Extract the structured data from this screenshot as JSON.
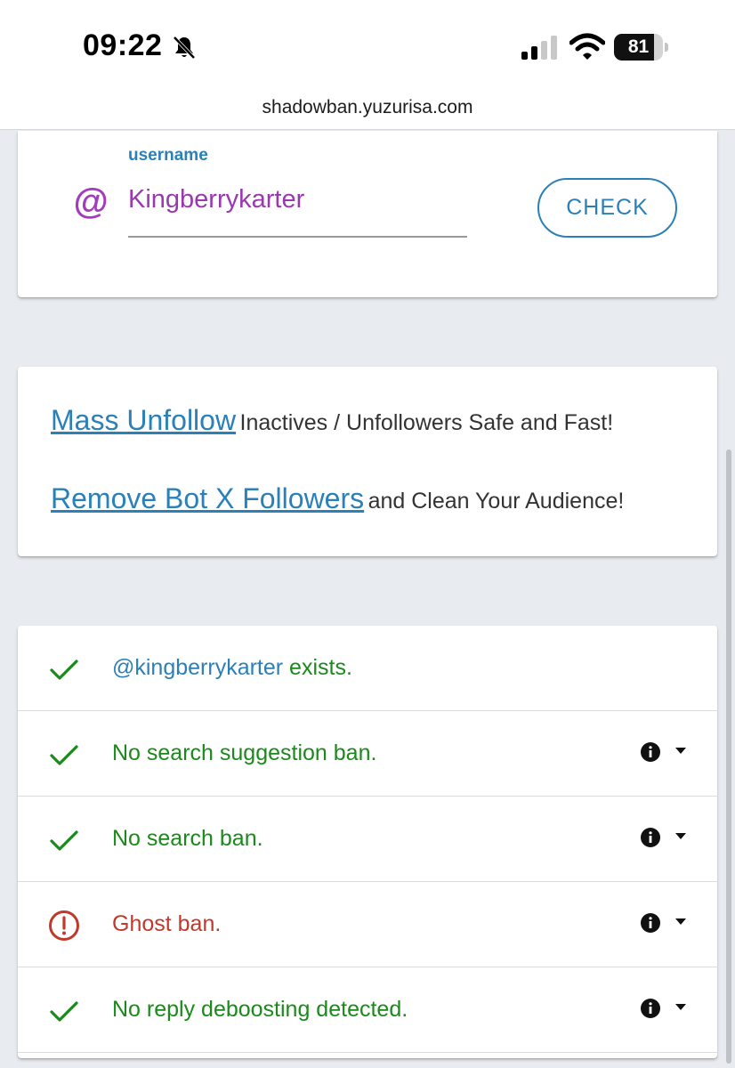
{
  "status_bar": {
    "time": "09:22",
    "battery_level": "81",
    "battery_fraction": 0.81,
    "icons": [
      "bell-slash-icon",
      "signal-icon",
      "wifi-icon",
      "battery-icon"
    ]
  },
  "browser": {
    "url": "shadowban.yuzurisa.com"
  },
  "search": {
    "label": "username",
    "prefix_symbol": "@",
    "value": "Kingberrykarter",
    "button_label": "CHECK",
    "accent_color": "#2a80b9",
    "input_color": "#9a38b0"
  },
  "promos": [
    {
      "link": "Mass Unfollow",
      "text": "Inactives / Unfollowers Safe and Fast!"
    },
    {
      "link": "Remove Bot X Followers",
      "text": "and Clean Your Audience!"
    }
  ],
  "results": [
    {
      "status": "ok",
      "icon": "check-icon",
      "handle": "@kingberrykarter",
      "text": " exists.",
      "has_info": false
    },
    {
      "status": "ok",
      "icon": "check-icon",
      "handle": "",
      "text": "No search suggestion ban.",
      "has_info": true
    },
    {
      "status": "ok",
      "icon": "check-icon",
      "handle": "",
      "text": "No search ban.",
      "has_info": true
    },
    {
      "status": "ban",
      "icon": "alert-circle-icon",
      "handle": "",
      "text": "Ghost ban.",
      "has_info": true
    },
    {
      "status": "ok",
      "icon": "check-icon",
      "handle": "",
      "text": "No reply deboosting detected.",
      "has_info": true
    }
  ],
  "colors": {
    "ok": "#1a8a1a",
    "ban": "#c0392b",
    "link": "#2a80b9",
    "background": "#e8ebef"
  }
}
